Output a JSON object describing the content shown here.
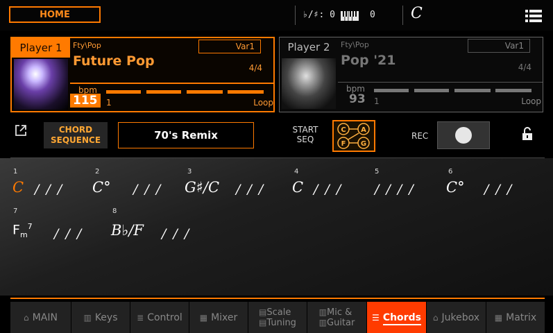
{
  "topbar": {
    "home_label": "HOME",
    "key_sig": "♭/♯: 0",
    "keyboard_value": "0",
    "chord": "C"
  },
  "players": [
    {
      "tab": "Player 1",
      "genre": "Fty\\Pop",
      "variation": "Var1",
      "style": "Future Pop",
      "meter": "4/4",
      "bpm_label": "bpm",
      "bpm": "115",
      "count": "1",
      "mode": "Loop"
    },
    {
      "tab": "Player 2",
      "genre": "Fty\\Pop",
      "variation": "Var1",
      "style": "Pop '21",
      "meter": "4/4",
      "bpm_label": "bpm",
      "bpm": "93",
      "count": "1",
      "mode": "Loop"
    }
  ],
  "sequence": {
    "chord_sequence_label_1": "CHORD",
    "chord_sequence_label_2": "SEQUENCE",
    "name": "70's Remix",
    "start_seq_1": "START",
    "start_seq_2": "SEQ",
    "diagram_letters": [
      "C",
      "A",
      "F",
      "G"
    ],
    "rec_label": "REC"
  },
  "chords": {
    "bars": [
      {
        "num": "1",
        "chord": "C",
        "slashes": "/ / /",
        "active": true
      },
      {
        "num": "2",
        "chord": "C°",
        "slashes": "/ / /"
      },
      {
        "num": "3",
        "chord": "G♯/C",
        "slashes": "/ / /"
      },
      {
        "num": "4",
        "chord": "C",
        "slashes": "/ / /"
      },
      {
        "num": "5",
        "chord": "",
        "slashes": "/ / / /"
      },
      {
        "num": "6",
        "chord": "C°",
        "slashes": "/ / /"
      },
      {
        "num": "7",
        "chord": "Fm7",
        "slashes": "/ / /"
      },
      {
        "num": "8",
        "chord": "B♭/F",
        "slashes": "/ / /"
      }
    ]
  },
  "nav": [
    {
      "label": "MAIN",
      "icon": "home-icon"
    },
    {
      "label": "Keys",
      "icon": "keys-icon"
    },
    {
      "label": "Control",
      "icon": "control-icon"
    },
    {
      "label": "Mixer",
      "icon": "mixer-icon"
    },
    {
      "label": "Scale",
      "label2": "Tuning",
      "icon": "scale-icon"
    },
    {
      "label": "Mic &",
      "label2": "Guitar",
      "icon": "mic-icon"
    },
    {
      "label": "Chords",
      "icon": "chords-icon",
      "active": true
    },
    {
      "label": "Jukebox",
      "icon": "jukebox-icon"
    },
    {
      "label": "Matrix",
      "icon": "matrix-icon"
    }
  ],
  "colors": {
    "accent": "#ff7a00",
    "active_tab": "#ff3b00"
  }
}
